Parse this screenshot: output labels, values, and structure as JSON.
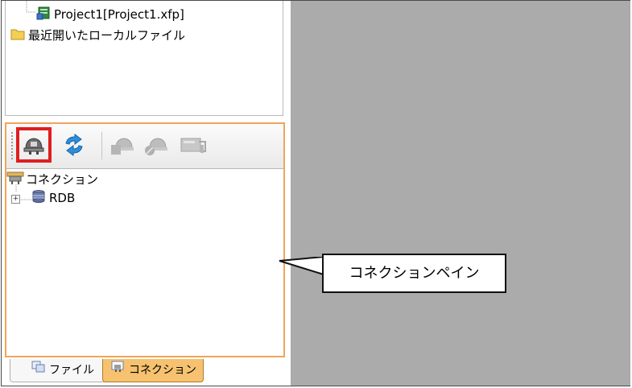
{
  "project_tree": {
    "project_item": "Project1[Project1.xfp]",
    "recent_files": "最近開いたローカルファイル"
  },
  "connection_pane": {
    "toolbar": {
      "connect_button": "connect",
      "refresh_button": "refresh",
      "add_button": "add-connection",
      "remove_button": "remove-connection",
      "properties_button": "connection-properties"
    },
    "root_label": "コネクション",
    "rdb_label": "RDB"
  },
  "tabs": {
    "file_tab": "ファイル",
    "connection_tab": "コネクション"
  },
  "callout": {
    "text": "コネクションペイン"
  },
  "colors": {
    "accent_orange": "#f0a55a",
    "highlight_red": "#e01e1e",
    "gray_area": "#ababab"
  }
}
